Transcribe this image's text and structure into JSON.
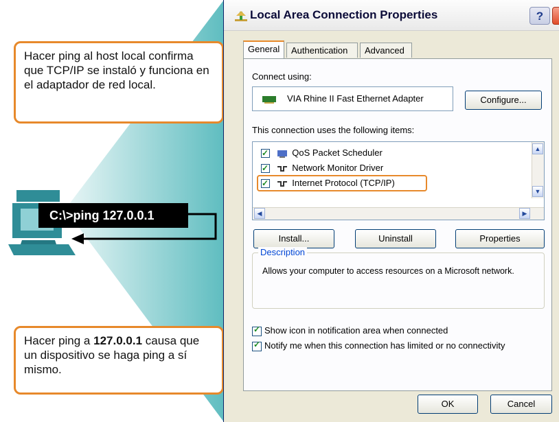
{
  "callouts": {
    "top": "Hacer ping al host local confirma que TCP/IP se instaló y funciona en el adaptador de red local.",
    "bottom_before": "Hacer ping a ",
    "bottom_ip": "127.0.0.1",
    "bottom_after": " causa que un dispositivo se haga ping a sí mismo."
  },
  "terminal": {
    "command": "C:\\>ping 127.0.0.1"
  },
  "dialog": {
    "title": "Local Area Connection Properties",
    "help": "?",
    "tabs": [
      "General",
      "Authentication",
      "Advanced"
    ],
    "connect_using_label": "Connect using:",
    "adapter_name": "VIA Rhine II Fast Ethernet Adapter",
    "configure_button": "Configure...",
    "items_label": "This connection uses the following items:",
    "items": [
      "QoS Packet Scheduler",
      "Network Monitor Driver",
      "Internet Protocol (TCP/IP)"
    ],
    "install_button": "Install...",
    "uninstall_button": "Uninstall",
    "properties_button": "Properties",
    "description_label": "Description",
    "description_text": "Allows your computer to access resources on a Microsoft network.",
    "show_icon_option": "Show icon in notification area when connected",
    "notify_option": "Notify me when this connection has limited or no connectivity",
    "ok_button": "OK",
    "cancel_button": "Cancel"
  },
  "colors": {
    "accent_orange": "#e7892b",
    "teal": "#6cc3c5",
    "computer": "#2f8d97"
  },
  "icons": [
    "computer-icon",
    "network-adapter-icon",
    "network-icon",
    "help-icon",
    "close-icon",
    "scroll-up-icon",
    "scroll-down-icon",
    "scroll-left-icon",
    "scroll-right-icon"
  ]
}
